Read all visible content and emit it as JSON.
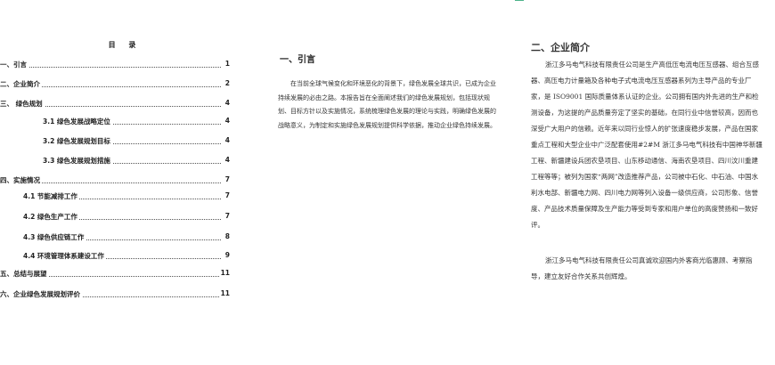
{
  "toc": {
    "title": "目  录",
    "entries": [
      {
        "title": "一、引言",
        "page": "1",
        "level": 0
      },
      {
        "title": "二、企业简介",
        "page": "2",
        "level": 0
      },
      {
        "title": "三、 绿色规划",
        "page": "4",
        "level": 0
      },
      {
        "title": "3.1 绿色发展战略定位",
        "page": "4",
        "level": 2
      },
      {
        "title": "3.2 绿色发展规划目标",
        "page": "4",
        "level": 2
      },
      {
        "title": "3.3 绿色发展规划措施",
        "page": "4",
        "level": 2
      },
      {
        "title": "四、实施情况",
        "page": "7",
        "level": 0
      },
      {
        "title": "4.1 节能减排工作",
        "page": "7",
        "level": 1
      },
      {
        "title": "4.2 绿色生产工作",
        "page": "7",
        "level": 1
      },
      {
        "title": "4.3 绿色供应链工作",
        "page": "8",
        "level": 1
      },
      {
        "title": "4.4 环境管理体系建设工作",
        "page": "9",
        "level": 1
      },
      {
        "title": "五、总结与展望",
        "page": "11",
        "level": 0
      },
      {
        "title": "六、企业绿色发展规划评价",
        "page": "11",
        "level": 0
      }
    ]
  },
  "intro": {
    "heading": "一、引言",
    "paragraph": "在当前全球气候变化和环境恶化的背景下，绿色发展全球共识，已成为企业持续发展的必由之路。本报告旨在全面阐述我们的绿色发展规划，包括现状规划、目标方针以及实施情况，系统梳理绿色发展的理论与实践，明确绿色发展的战略意义，为制定和实施绿色发展规划提供科学依据，推动企业绿色持续发展。"
  },
  "company": {
    "heading": "二、企业简介",
    "paragraph1": "浙江多马电气科技有限责任公司是生产高低压电流电压互感器、组合互感器、高压电力计量箱及各种电子式电流电压互感器系列为主导产品的专业厂家，是 ISO9001 国际质量体系认证的企业。公司拥有国内外先进的生产和检测设备，为这提的产品质量夯定了坚实的基础，在同行业中信誉较高，因而也深受广大用户的信赖。近年来以同行业惊人的扩张速度稳步发展，产品在国家重点工程和大型企业中广泛配套使用#2#M 浙江多马电气科技有中国神华新疆工程、新疆建设兵团农垦项目、山东移动通信、海南农垦项目、四川汶川重建工程等等；被列为国家“两网”改造推荐产品，公司被中石化、中石油、中国水利水电部、新疆电力网、四川电力网等列入设备一级供应商，公司形象、信誉度、产品技术质量保障及生产能力等受到专家和用户单位的高度赞扬和一致好评。",
    "paragraph2": "浙江多马电气科技有限责任公司真诚欢迎国内外客商光临惠顾、考察指导，建立友好合作关系共创辉煌。"
  }
}
